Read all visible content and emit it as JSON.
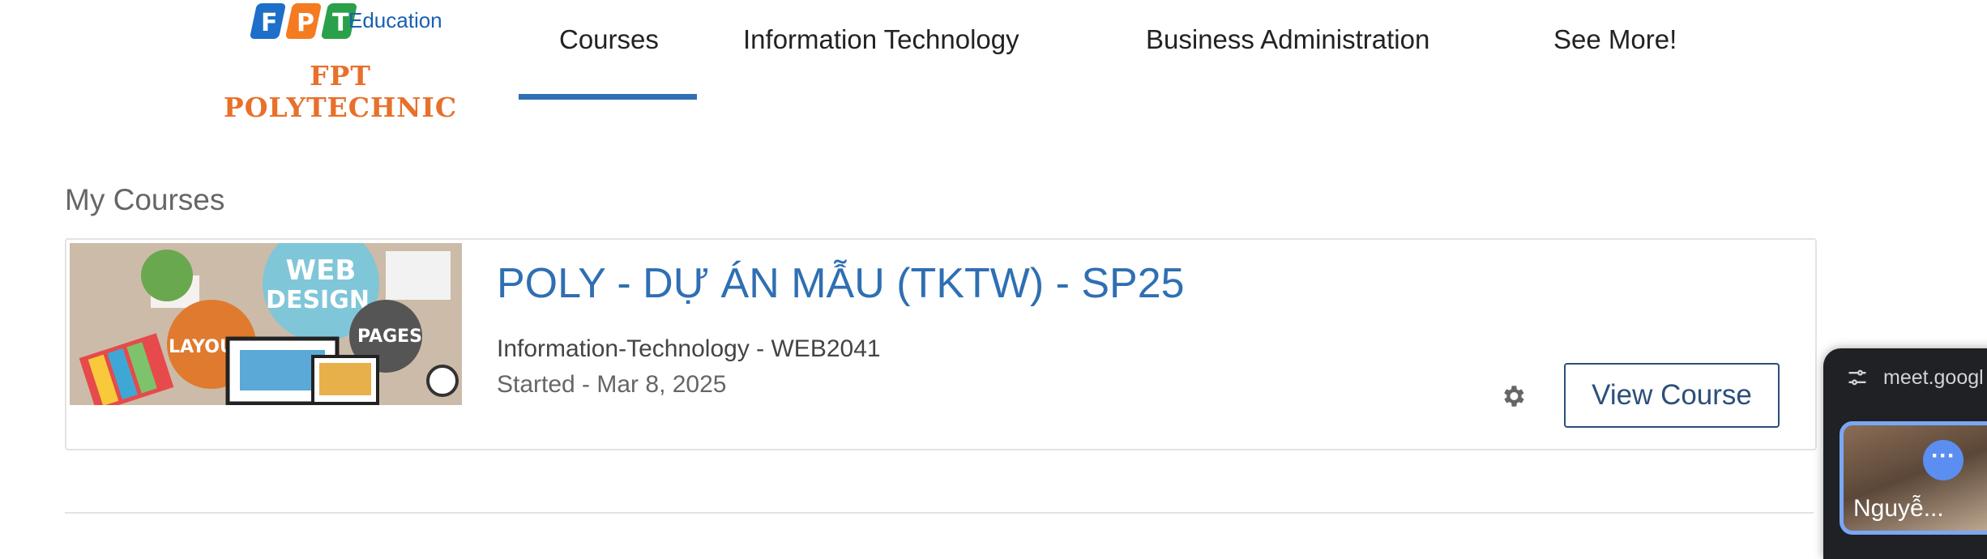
{
  "logo": {
    "letters": [
      "F",
      "P",
      "T"
    ],
    "education": "Education",
    "wordmark": "FPT POLYTECHNIC",
    "colors": {
      "f": "#1d6fc9",
      "p": "#f47b20",
      "t": "#2aa04a",
      "wordmark": "#e8702a"
    }
  },
  "nav": {
    "items": [
      {
        "label": "Courses",
        "active": true
      },
      {
        "label": "Information Technology",
        "active": false
      },
      {
        "label": "Business Administration",
        "active": false
      },
      {
        "label": "See More!",
        "active": false
      }
    ]
  },
  "main": {
    "section_title": "My Courses",
    "course": {
      "thumbnail": {
        "words": [
          "WEB",
          "DESIGN",
          "LAYOUT",
          "PAGES"
        ]
      },
      "title": "POLY - DỰ ÁN MẪU (TKTW) - SP25",
      "subtitle": "Information-Technology - WEB2041",
      "started": "Started - Mar 8, 2025",
      "settings_icon": "gear-icon",
      "view_button": "View Course"
    }
  },
  "meet": {
    "url": "meet.googl",
    "participant": "Nguyễ...",
    "more_icon": "more-horizontal-icon",
    "tune_icon": "tune-icon"
  },
  "colors": {
    "accent": "#2f6fb3",
    "button_border": "#2b4f7a",
    "meet_bg": "#202124"
  }
}
